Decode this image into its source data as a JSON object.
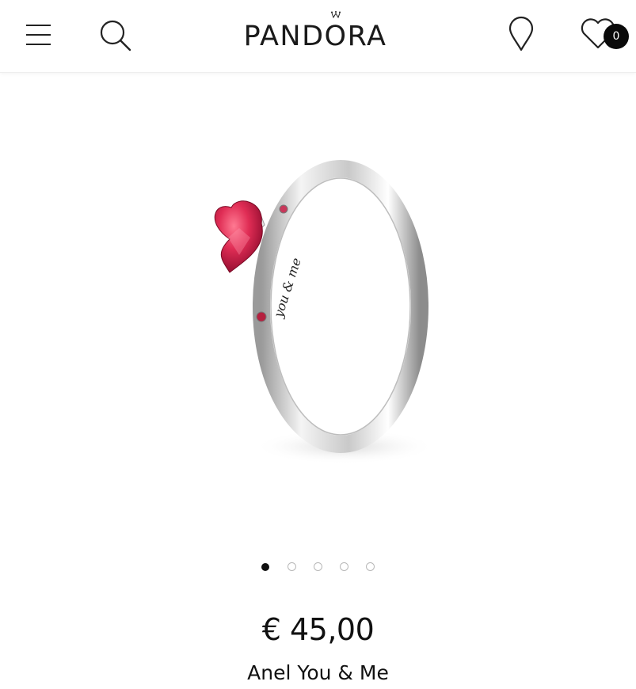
{
  "header": {
    "brand": "PANDORA",
    "icons": {
      "menu": "hamburger-menu-icon",
      "search": "search-icon",
      "store": "location-pin-icon",
      "wishlist": "heart-icon"
    },
    "wishlist_count": "0"
  },
  "gallery": {
    "image_alt": "Anel You & Me",
    "engraving": "you & me",
    "slide_count": 5,
    "active_slide": 1
  },
  "product": {
    "price": "€ 45,00",
    "name": "Anel You & Me"
  },
  "colors": {
    "accent": "#111111",
    "stone": "#d42a4f",
    "badge": "#0a0a0a"
  }
}
